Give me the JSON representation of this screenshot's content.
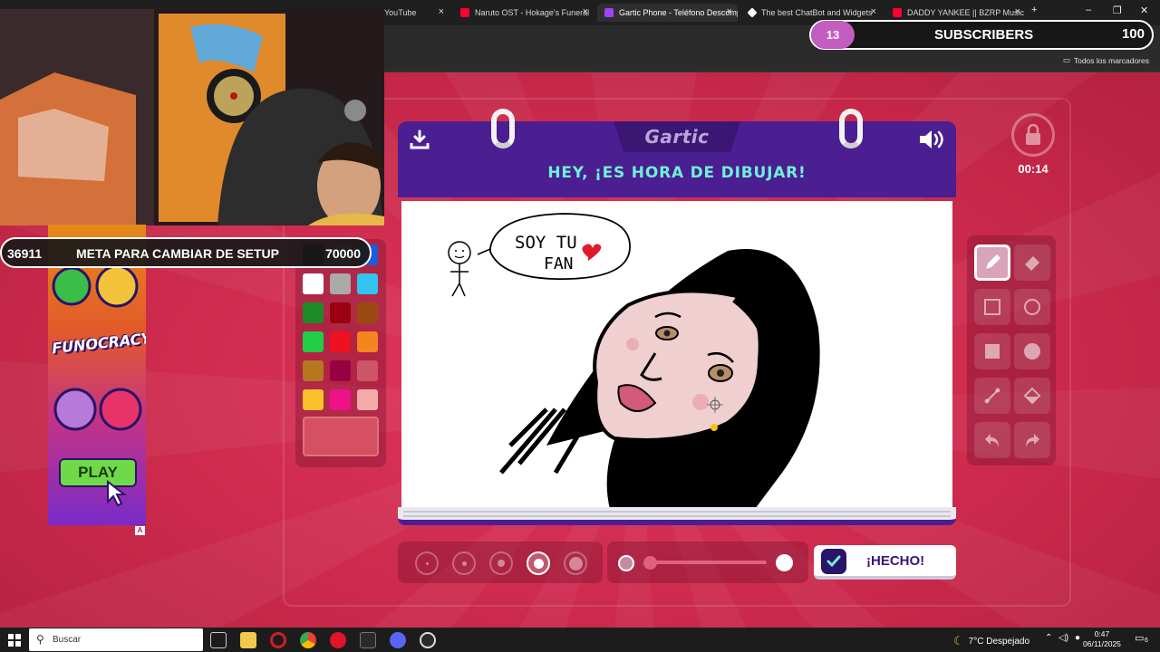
{
  "browser": {
    "tabs": [
      {
        "label": "YouTube",
        "color": "#ff0000"
      },
      {
        "label": "Naruto OST - Hokage's Funeral",
        "color": "#ff0033"
      },
      {
        "label": "Gartic Phone - Teléfono Descompuesto",
        "color": "#a142f4",
        "active": true
      },
      {
        "label": "The best ChatBot and Widgets",
        "color": "#ffffff"
      },
      {
        "label": "DADDY YANKEE || BZRP Music Sessions",
        "color": "#ff0033"
      }
    ],
    "new_tab": "+",
    "bookmarks_label": "Todos los marcadores"
  },
  "game": {
    "logo": "Gartic",
    "headline": "HEY, ¡ES HORA DE DIBUJAR!",
    "timer": "00:14",
    "done_label": "¡HECHO!",
    "drawing_text_1": "SOY TU",
    "drawing_text_2": "FAN",
    "palette": [
      "#000000",
      "#666666",
      "#1e5bd8",
      "#ffffff",
      "#aaaaaa",
      "#33c3f0",
      "#1f8a28",
      "#990011",
      "#9b4a12",
      "#22cc44",
      "#ee1122",
      "#f5851f",
      "#b5781e",
      "#990044",
      "#cc5566",
      "#f7c12a",
      "#ee1188",
      "#f5aaaa"
    ],
    "current_color": "#d55060",
    "brush_sizes": 5,
    "selected_brush_index": 3,
    "opacity_value": 1.0
  },
  "overlay": {
    "subscribers_count": "13",
    "subscribers_label": "SUBSCRIBERS",
    "subscribers_goal": "100",
    "goal_current": "36911",
    "goal_label": "META PARA CAMBIAR DE SETUP",
    "goal_target": "70000",
    "ad_logo": "FUNOCRACY",
    "ad_button": "PLAY",
    "ad_marker": "A"
  },
  "taskbar": {
    "search_placeholder": "Buscar",
    "weather": "7°C  Despejado",
    "time": "0:47",
    "date": "06/11/2025",
    "notifications": "6"
  }
}
